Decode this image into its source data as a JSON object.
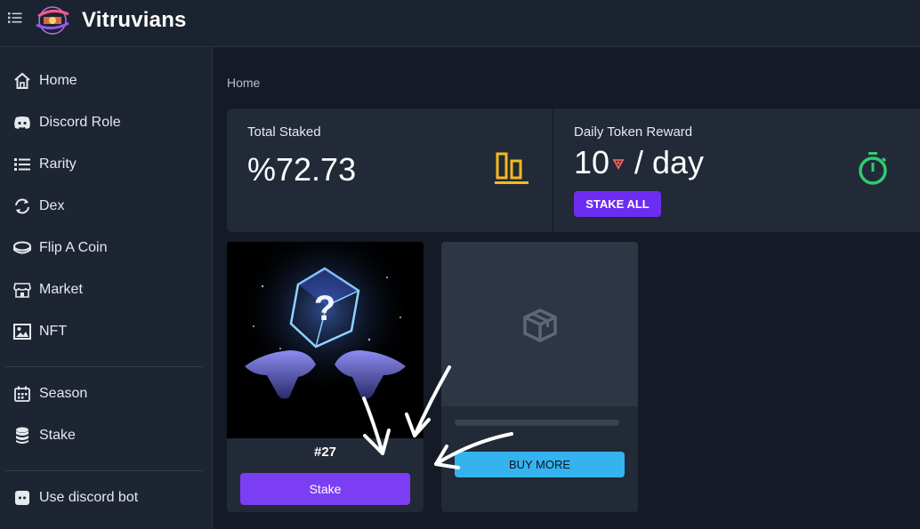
{
  "app": {
    "title": "Vitruvians"
  },
  "sidebar": {
    "items": [
      {
        "label": "Home",
        "icon": "home-icon"
      },
      {
        "label": "Discord Role",
        "icon": "discord-icon"
      },
      {
        "label": "Rarity",
        "icon": "list-icon"
      },
      {
        "label": "Dex",
        "icon": "swap-icon"
      },
      {
        "label": "Flip A Coin",
        "icon": "coin-icon"
      },
      {
        "label": "Market",
        "icon": "store-icon"
      },
      {
        "label": "NFT",
        "icon": "image-icon"
      },
      {
        "label": "Season",
        "icon": "calendar-icon"
      },
      {
        "label": "Stake",
        "icon": "database-icon"
      },
      {
        "label": "Use discord bot",
        "icon": "discord-icon"
      }
    ]
  },
  "breadcrumb": "Home",
  "stats": {
    "total_staked": {
      "label": "Total Staked",
      "value": "%72.73",
      "icon": "bar-chart-icon",
      "icon_color": "#f5b921"
    },
    "daily_reward": {
      "label": "Daily Token Reward",
      "amount": "10",
      "unit": "/ day",
      "icon": "stopwatch-icon",
      "icon_color": "#2ecc71",
      "button": "STAKE ALL"
    }
  },
  "nft": {
    "number": "#27",
    "button": "Stake"
  },
  "buy": {
    "button": "BUY MORE",
    "icon": "box-icon"
  },
  "colors": {
    "accent": "#7b3ef3",
    "buy": "#35b3ee",
    "background": "#141b26",
    "card": "#222a37"
  }
}
